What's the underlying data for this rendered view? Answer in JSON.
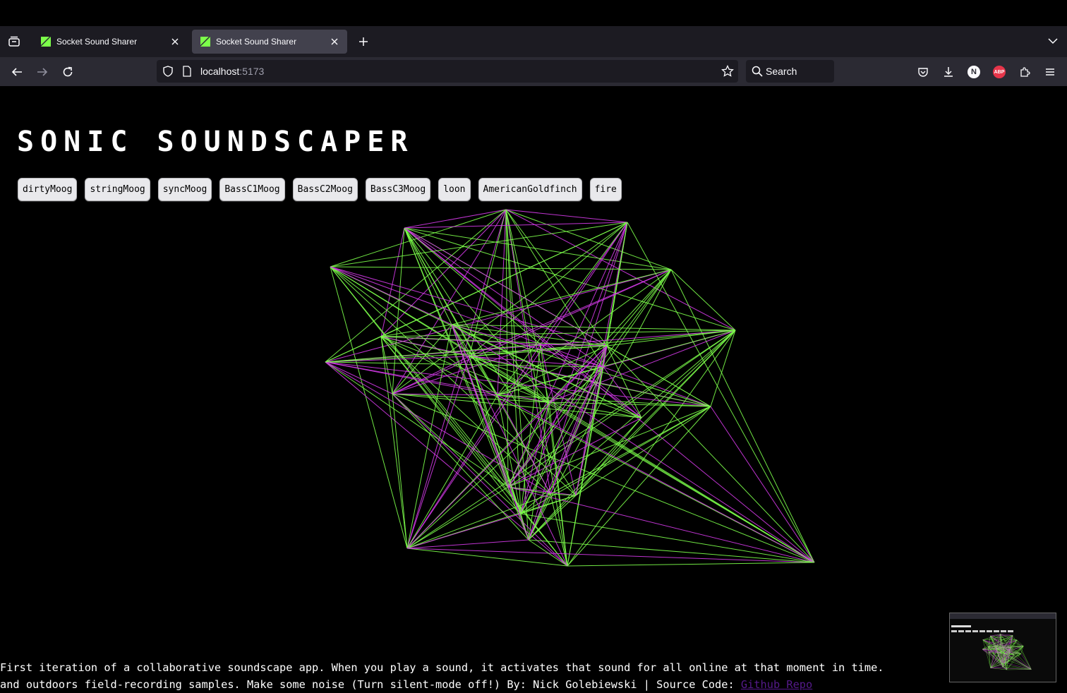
{
  "browser": {
    "tabs": [
      {
        "title": "Socket Sound Sharer",
        "active": false
      },
      {
        "title": "Socket Sound Sharer",
        "active": true
      }
    ],
    "url_host": "localhost",
    "url_port": ":5173",
    "search_placeholder": "Search",
    "profile_initial": "N",
    "adblock_label": "ABP"
  },
  "page": {
    "title": "SONIC SOUNDSCAPER",
    "sound_buttons": [
      "dirtyMoog",
      "stringMoog",
      "syncMoog",
      "BassC1Moog",
      "BassC2Moog",
      "BassC3Moog",
      "loon",
      "AmericanGoldfinch",
      "fire"
    ],
    "footer": {
      "line1": "First iteration of a collaborative soundscape app. When you play a sound, it activates that sound for all online at that moment in time.",
      "line2_prefix": "and outdoors field-recording samples. Make some noise (Turn silent-mode off!) By: Nick Golebiewski | Source Code: ",
      "link_text": "Github Repo"
    },
    "colors": {
      "green": "#7cff4a",
      "magenta": "#d43ae8",
      "background": "#000000"
    }
  }
}
